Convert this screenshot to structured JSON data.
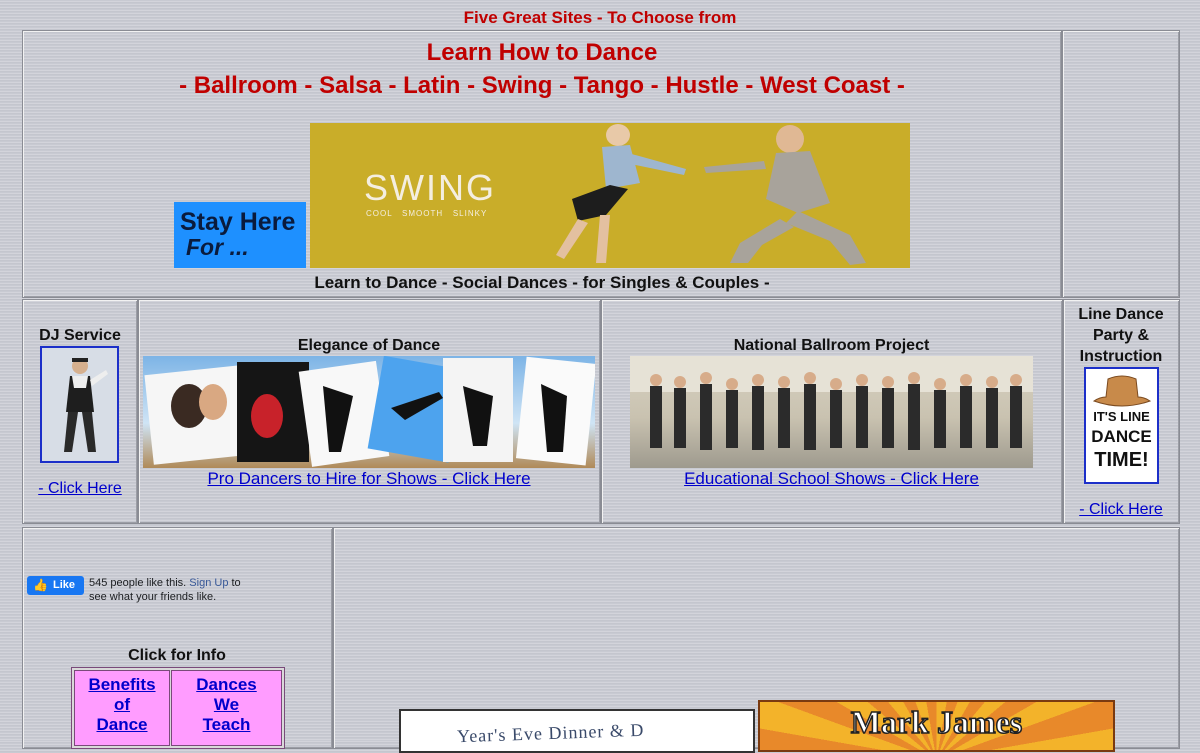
{
  "top_banner": "Five Great Sites - To Choose from",
  "hero": {
    "title": "Learn How to Dance",
    "styles_line": "- Ballroom - Salsa - Latin - Swing - Tango - Hustle - West Coast -",
    "stay_here_line1": "Stay Here",
    "stay_here_line2": "For ...",
    "swing_title": "SWING",
    "swing_tagline": "COOL   SMOOTH   SLINKY",
    "subtitle": "Learn to Dance - Social Dances - for Singles & Couples -"
  },
  "dj": {
    "title": "DJ Service",
    "link": "- Click Here"
  },
  "elegance": {
    "title": "Elegance of Dance",
    "link": "Pro Dancers to Hire for Shows - Click Here"
  },
  "national": {
    "title": "National Ballroom Project",
    "link": "Educational School Shows - Click Here"
  },
  "line_dance": {
    "title_l1": "Line Dance",
    "title_l2": "Party &",
    "title_l3": "Instruction",
    "sign_l1": "IT'S LINE",
    "sign_l2": "DANCE",
    "sign_l3": "TIME!",
    "link": "- Click Here"
  },
  "facebook": {
    "like_label": "Like",
    "count_text": "545 people like this.",
    "signup": "Sign Up",
    "tail": "to see what your friends like."
  },
  "info": {
    "heading": "Click for Info",
    "box1_l1": "Benefits",
    "box1_l2": "of",
    "box1_l3": "Dance",
    "box2_l1": "Dances",
    "box2_l2": "We",
    "box2_l3": "Teach"
  },
  "bottom": {
    "nye_text": "Year's Eve Dinner & D",
    "mark_james": "Mark James"
  },
  "colors": {
    "heading_red": "#c00000",
    "link_blue": "#0000cc",
    "info_pink": "#ff9cff",
    "swing_bg": "#c9ad29",
    "stay_bg": "#1e90ff"
  }
}
